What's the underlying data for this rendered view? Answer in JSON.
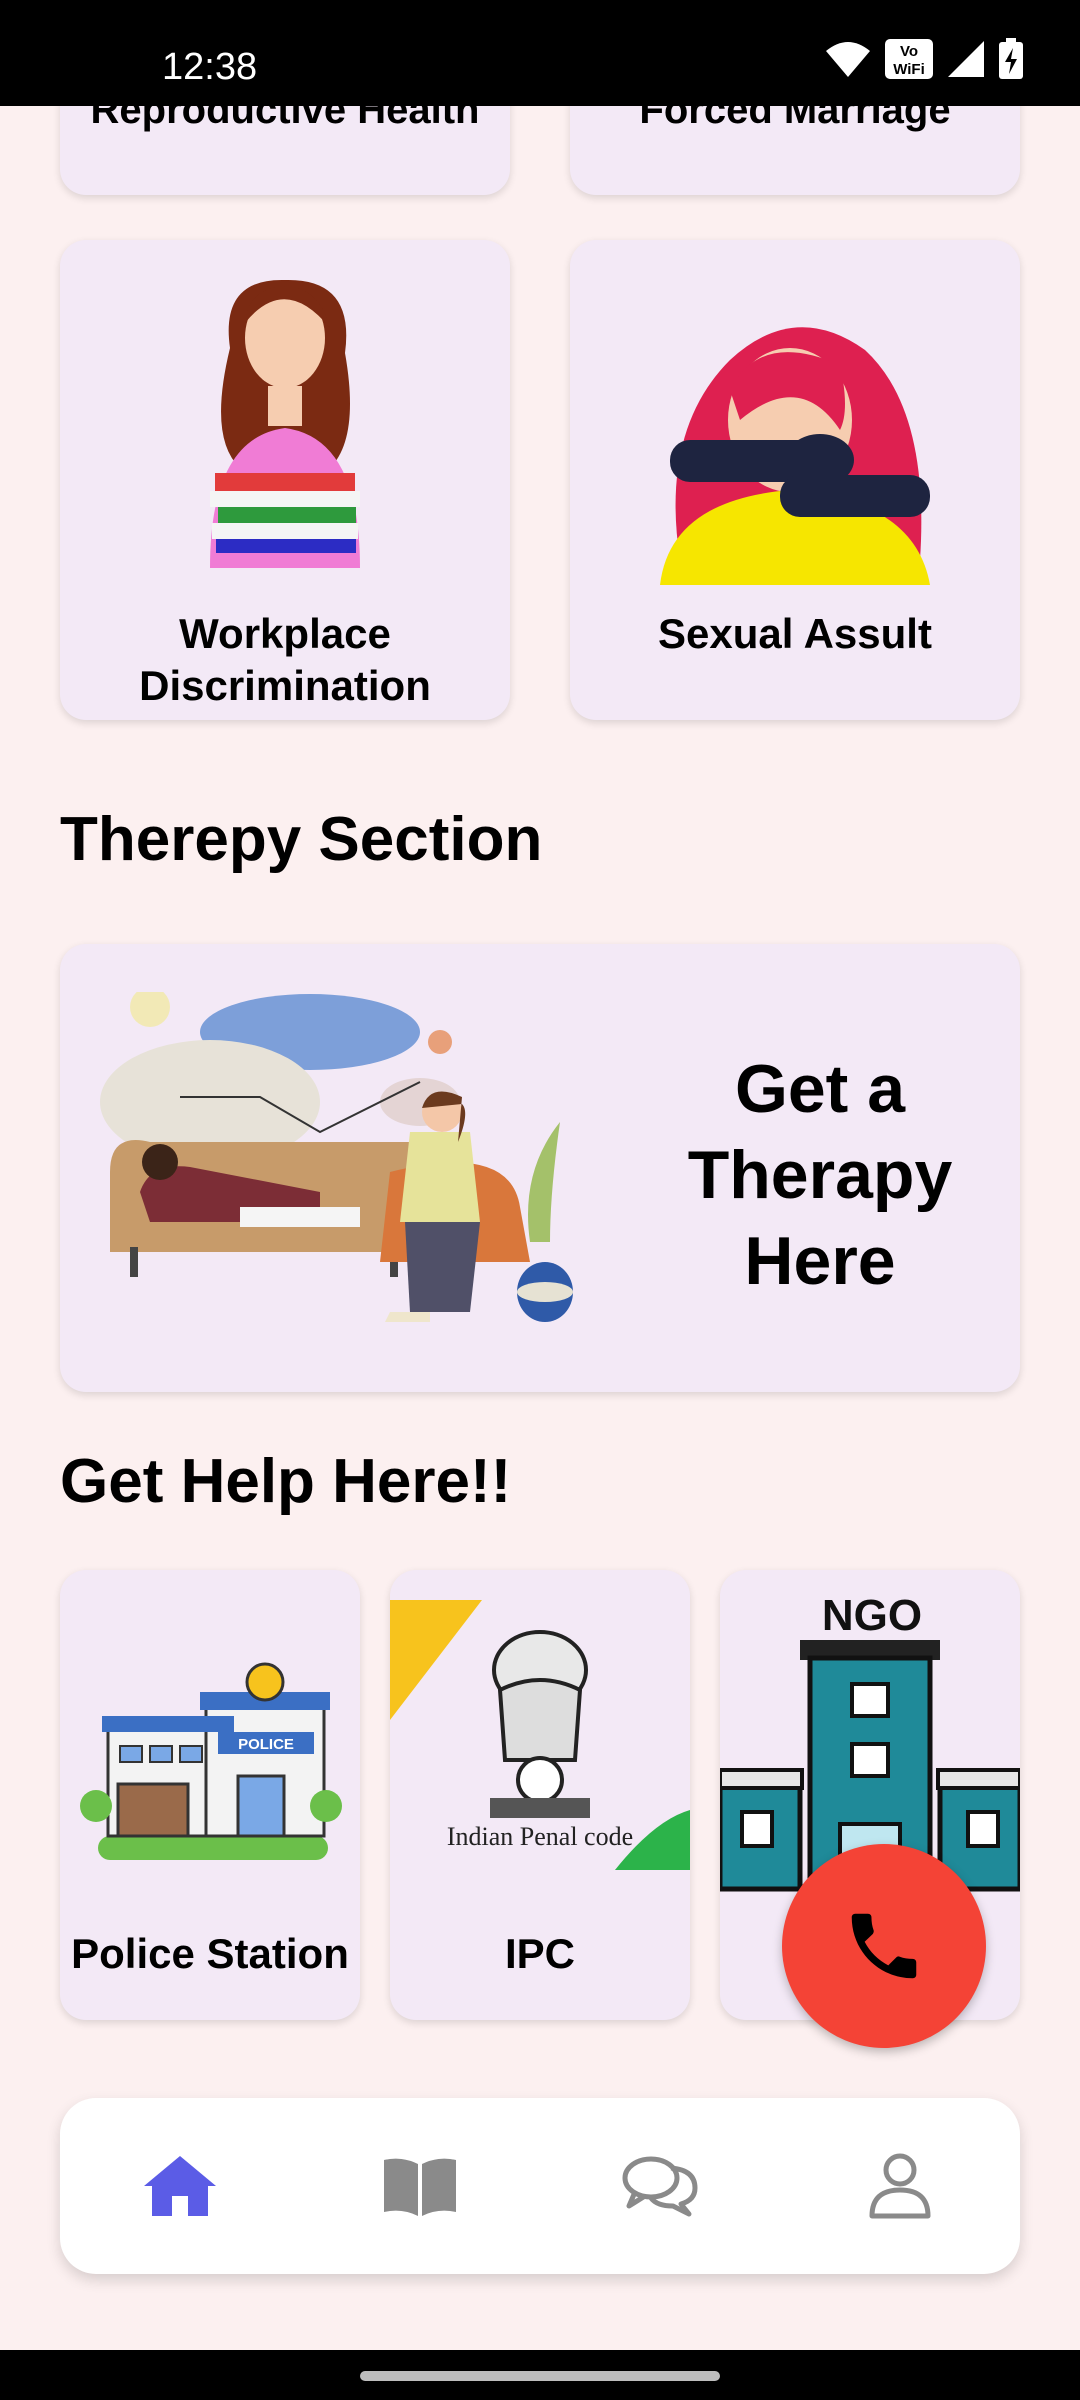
{
  "status_bar": {
    "time": "12:38",
    "volte_label": "VoWiFi"
  },
  "categories_partial": [
    {
      "label": "Reproductive Health"
    },
    {
      "label": "Forced Marriage"
    }
  ],
  "categories": [
    {
      "label": "Workplace Discrimination"
    },
    {
      "label": "Sexual Assult"
    }
  ],
  "therapy": {
    "section_title": "Therepy Section",
    "card_text": "Get a Therapy Here"
  },
  "help": {
    "section_title": "Get Help Here!!",
    "items": [
      {
        "label": "Police Station",
        "image_text": "POLICE"
      },
      {
        "label": "IPC",
        "image_text": "Indian Penal code"
      },
      {
        "label": "NGO",
        "image_text": "NGO"
      }
    ]
  },
  "bottom_nav": {
    "items": [
      {
        "icon": "home-icon",
        "active": true
      },
      {
        "icon": "book-icon",
        "active": false
      },
      {
        "icon": "chat-icon",
        "active": false
      },
      {
        "icon": "profile-icon",
        "active": false
      }
    ],
    "active_color": "#5b5ce6",
    "inactive_color": "#8a8a8a"
  },
  "colors": {
    "background": "#fcf0f0",
    "card": "#f3e9f6",
    "sos": "#f44336"
  }
}
